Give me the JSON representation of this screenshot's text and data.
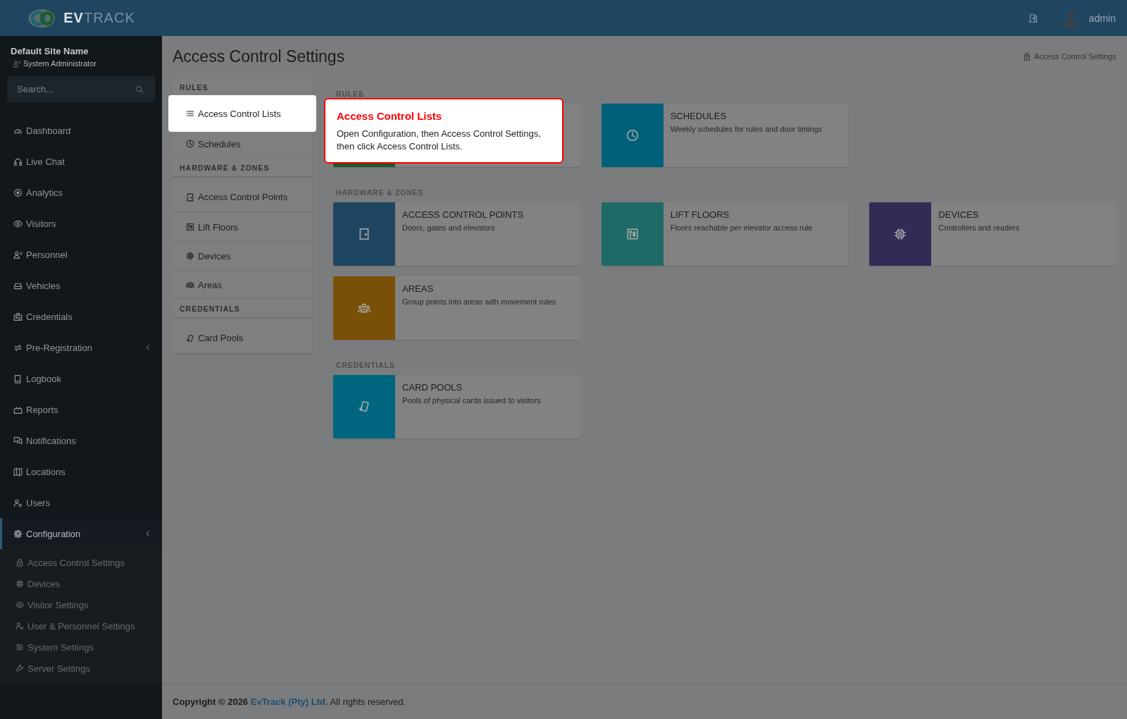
{
  "header": {
    "logo": "**EV**TRACK",
    "user": "admin"
  },
  "sidebar": {
    "site": "Default Site Name",
    "role": "System Administrator",
    "search": {
      "placeholder": "Search..."
    },
    "items": [
      {
        "label": "Dashboard",
        "selected": false,
        "kind": "link"
      },
      {
        "label": "Live Chat",
        "selected": false,
        "kind": "link"
      },
      {
        "label": "Analytics",
        "selected": false,
        "kind": "link"
      },
      {
        "label": "Visitors",
        "selected": false,
        "kind": "link"
      },
      {
        "label": "Personnel",
        "selected": false,
        "kind": "link"
      },
      {
        "label": "Vehicles",
        "selected": false,
        "kind": "link"
      },
      {
        "label": "Credentials",
        "selected": false,
        "kind": "link"
      },
      {
        "label": "Pre-Registration",
        "selected": false,
        "kind": "group"
      },
      {
        "label": "Logbook",
        "selected": false,
        "kind": "link"
      },
      {
        "label": "Reports",
        "selected": false,
        "kind": "link"
      },
      {
        "label": "Notifications",
        "selected": false,
        "kind": "link"
      },
      {
        "label": "Locations",
        "selected": false,
        "kind": "link"
      },
      {
        "label": "Users",
        "selected": false,
        "kind": "link"
      },
      {
        "label": "Configuration",
        "selected": true,
        "kind": "group",
        "children": [
          {
            "label": "Access Control Settings"
          },
          {
            "label": "Devices"
          },
          {
            "label": "Visitor Settings"
          },
          {
            "label": "User & Personnel Settings"
          },
          {
            "label": "System Settings"
          },
          {
            "label": "Server Settings"
          }
        ]
      }
    ]
  },
  "page": {
    "title": "Access Control Settings",
    "breadcrumb": "Access Control Settings"
  },
  "subnav": [
    {
      "title": "RULES",
      "items": [
        {
          "label": "Access Control Lists",
          "selected": true
        },
        {
          "label": "Schedules",
          "selected": false
        }
      ]
    },
    {
      "title": "HARDWARE & ZONES",
      "items": [
        {
          "label": "Access Control Points",
          "selected": false
        },
        {
          "label": "Lift Floors",
          "selected": false
        },
        {
          "label": "Devices",
          "selected": false
        },
        {
          "label": "Areas",
          "selected": false
        }
      ]
    },
    {
      "title": "CREDENTIALS",
      "items": [
        {
          "label": "Card Pools",
          "selected": false
        }
      ]
    }
  ],
  "sections": [
    {
      "title": "RULES",
      "cards": [
        {
          "color": "#1e5a2a"
        },
        {
          "title": "SCHEDULES",
          "description": "Weekly schedules for rules and door timings",
          "color": "#00607a"
        }
      ]
    },
    {
      "title": "HARDWARE & ZONES",
      "cards": [
        {
          "title": "ACCESS CONTROL POINTS",
          "description": "Doors, gates and elevators",
          "color": "#1e4662"
        },
        {
          "title": "LIFT FLOORS",
          "description": "Floors reachable per elevator access rule",
          "color": "#1e6a66"
        },
        {
          "title": "DEVICES",
          "description": "Controllers and readers",
          "color": "#302c55"
        },
        {
          "title": "AREAS",
          "description": "Group points into areas with movement rules",
          "color": "#7a5008"
        }
      ]
    },
    {
      "title": "CREDENTIALS",
      "cards": [
        {
          "title": "CARD POOLS",
          "description": "Pools of physical cards issued to visitors",
          "color": "#00667f"
        }
      ]
    }
  ],
  "tooltip": {
    "title": "Access Control Lists",
    "text": "Open Configuration, then Access Control Settings, then click Access Control Lists."
  },
  "footer": {
    "prefix": "Copyright © 2026",
    "link": "EvTrack (Pty) Ltd.",
    "suffix": "All rights reserved."
  }
}
